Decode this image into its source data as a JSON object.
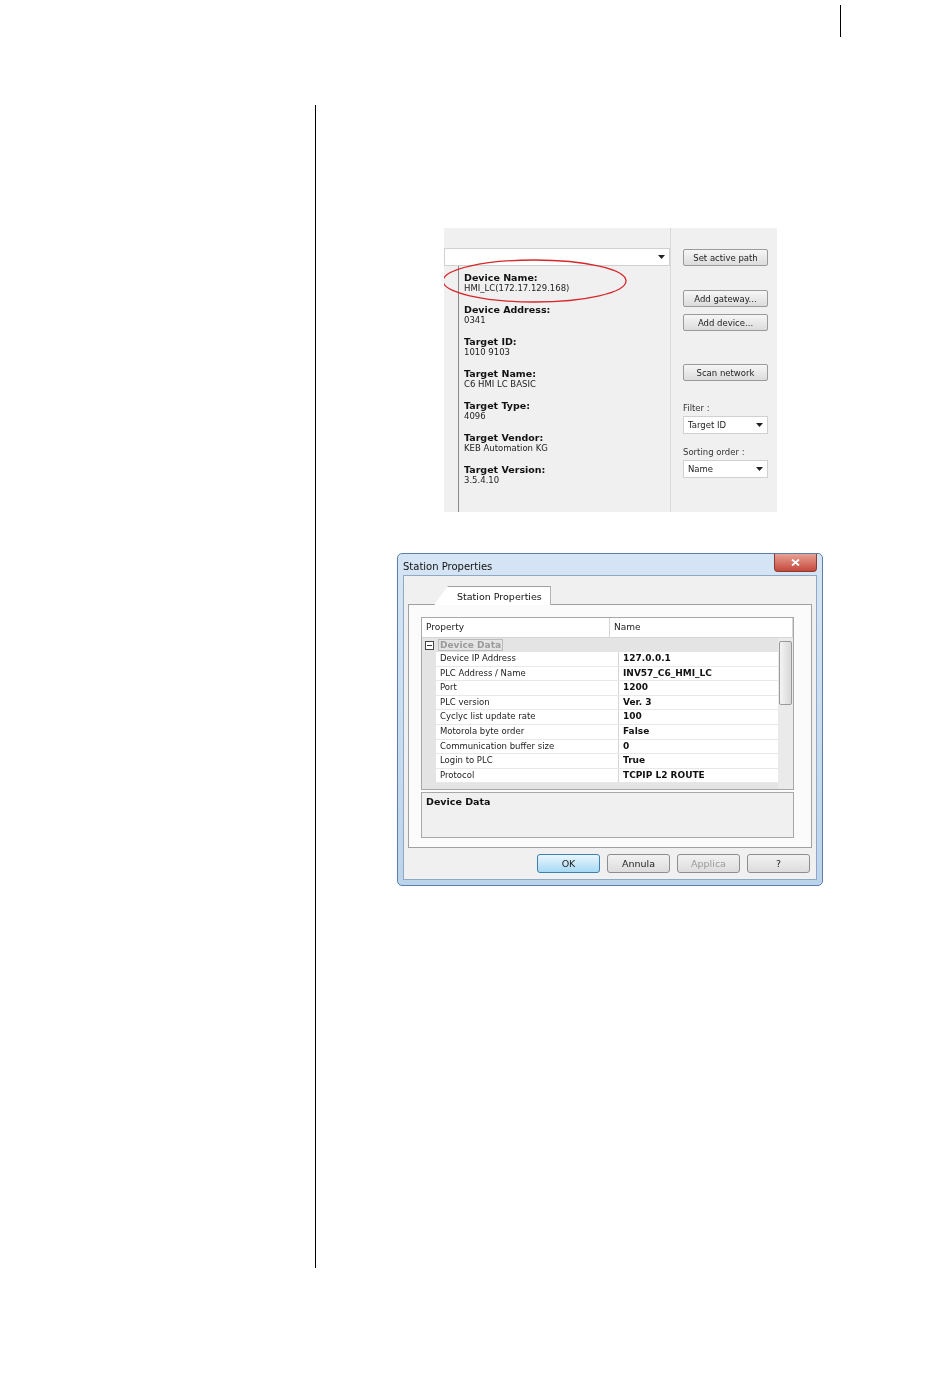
{
  "device_panel": {
    "fields": [
      {
        "label": "Device Name:",
        "value": "HMI_LC(172.17.129.168)",
        "highlighted": true
      },
      {
        "label": "Device Address:",
        "value": "0341",
        "highlighted": false
      },
      {
        "label": "Target ID:",
        "value": "1010 9103",
        "highlighted": false
      },
      {
        "label": "Target Name:",
        "value": "C6 HMI LC BASIC",
        "highlighted": false
      },
      {
        "label": "Target Type:",
        "value": "4096",
        "highlighted": false
      },
      {
        "label": "Target Vendor:",
        "value": "KEB Automation KG",
        "highlighted": false
      },
      {
        "label": "Target Version:",
        "value": "3.5.4.10",
        "highlighted": false
      }
    ],
    "buttons": [
      "Set active path",
      "Add gateway...",
      "Add device...",
      "Scan network"
    ],
    "filter": {
      "label": "Filter :",
      "value": "Target ID"
    },
    "sorting_order": {
      "label": "Sorting order :",
      "value": "Name"
    }
  },
  "dialog": {
    "title": "Station Properties",
    "tab": {
      "label": "Station Properties",
      "selected": true
    },
    "columns": [
      "Property",
      "Name"
    ],
    "category": {
      "label": "Device Data",
      "expanded": true
    },
    "rows": [
      {
        "property": "Device IP Address",
        "value": "127.0.0.1"
      },
      {
        "property": "PLC Address / Name",
        "value": "INV57_C6_HMI_LC"
      },
      {
        "property": "Port",
        "value": "1200"
      },
      {
        "property": "PLC version",
        "value": "Ver. 3"
      },
      {
        "property": "Cyclyc list update rate",
        "value": "100"
      },
      {
        "property": "Motorola byte order",
        "value": "False"
      },
      {
        "property": "Communication buffer size",
        "value": "0"
      },
      {
        "property": "Login to PLC",
        "value": "True"
      },
      {
        "property": "Protocol",
        "value": "TCPIP L2 ROUTE"
      }
    ],
    "description": "Device Data",
    "buttons": [
      {
        "label": "OK",
        "default": true,
        "disabled": false
      },
      {
        "label": "Annula",
        "default": false,
        "disabled": false
      },
      {
        "label": "Applica",
        "default": false,
        "disabled": true
      },
      {
        "label": "?",
        "default": false,
        "disabled": false
      }
    ]
  }
}
